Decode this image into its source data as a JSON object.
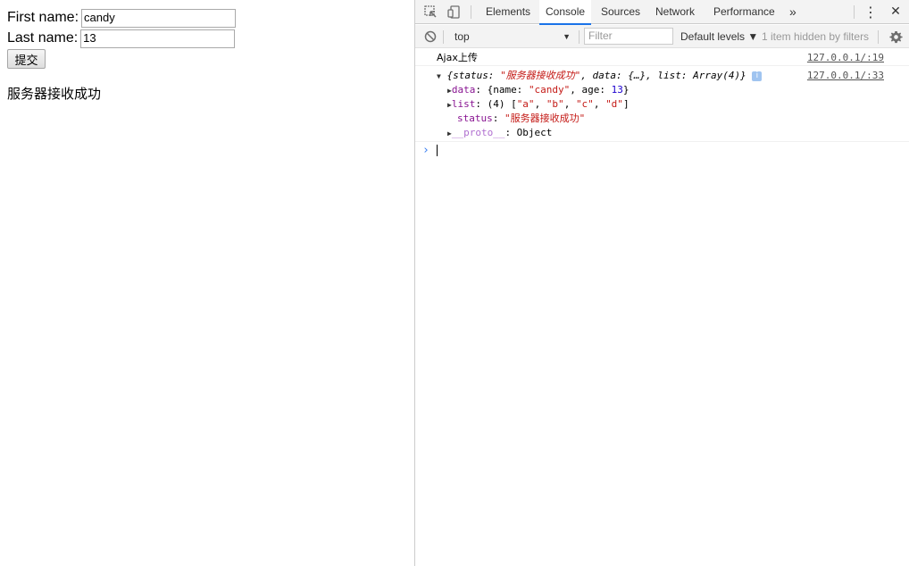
{
  "page": {
    "first_name_label": "First name:",
    "first_name_value": "candy",
    "last_name_label": "Last name:",
    "last_name_value": "13",
    "submit_label": "提交",
    "response_text": "服务器接收成功"
  },
  "devtools": {
    "tabs": [
      "Elements",
      "Console",
      "Sources",
      "Network",
      "Performance"
    ],
    "active_tab": "Console",
    "more_tabs_icon": "»",
    "menu_icon": "⋮",
    "close_icon": "✕",
    "context": "top",
    "filter_placeholder": "Filter",
    "levels": "Default levels ▼",
    "hidden_note": "1 item hidden by filters",
    "accent_color": "#1a73e8"
  },
  "console": {
    "log1": {
      "text": "Ajax上传",
      "source": "127.0.0.1/:19"
    },
    "log2": {
      "source": "127.0.0.1/:33",
      "summary_open": "{status: ",
      "summary_status": "\"服务器接收成功\"",
      "summary_mid": ", data: {…}, list: Array(4)}",
      "data_key": "data",
      "data_value_pre": ": {name: ",
      "data_name": "\"candy\"",
      "data_age_pre": ", age: ",
      "data_age": "13",
      "data_close": "}",
      "list_key": "list",
      "list_count": ": (4) [",
      "list_items": [
        "\"a\"",
        "\"b\"",
        "\"c\"",
        "\"d\""
      ],
      "list_close": "]",
      "status_key": "status",
      "status_value": "\"服务器接收成功\"",
      "proto_key": "__proto__",
      "proto_value": ": Object"
    },
    "prompt": "›"
  }
}
